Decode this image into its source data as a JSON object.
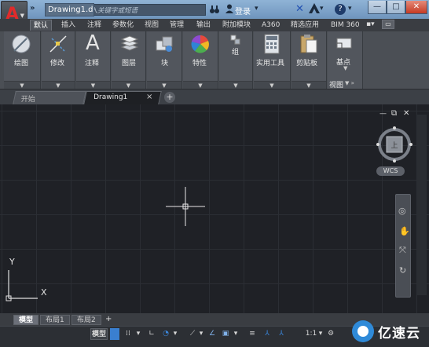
{
  "titlebar": {
    "document_title": "Drawing1.d...",
    "search_placeholder": "键入关键字或短语",
    "login_label": "登录",
    "help_label": "?",
    "min_label": "—",
    "max_label": "□",
    "close_label": "✕"
  },
  "ribbon_tabs": [
    {
      "label": "默认",
      "active": true
    },
    {
      "label": "插入"
    },
    {
      "label": "注释"
    },
    {
      "label": "参数化"
    },
    {
      "label": "视图"
    },
    {
      "label": "管理"
    },
    {
      "label": "输出"
    },
    {
      "label": "附加模块"
    },
    {
      "label": "A360"
    },
    {
      "label": "精选应用"
    },
    {
      "label": "BIM 360"
    }
  ],
  "ribbon_panels": [
    {
      "label": "绘图",
      "icon": "draw-icon"
    },
    {
      "label": "修改",
      "icon": "modify-icon"
    },
    {
      "label": "注释",
      "icon": "annotate-icon",
      "glyph": "A"
    },
    {
      "label": "图层",
      "icon": "layers-icon"
    },
    {
      "label": "块",
      "icon": "block-icon"
    },
    {
      "label": "特性",
      "icon": "properties-icon"
    },
    {
      "label": "组",
      "icon": "group-icon"
    },
    {
      "label": "实用工具",
      "icon": "utilities-icon"
    },
    {
      "label": "剪贴板",
      "icon": "clipboard-icon"
    },
    {
      "label": "基点",
      "icon": "basepoint-icon"
    },
    {
      "label": "视图",
      "icon": "view-panel"
    }
  ],
  "doc_tabs": {
    "start": "开始",
    "drawing": "Drawing1",
    "close": "×",
    "add": "+"
  },
  "viewcube": {
    "wcs_label": "WCS",
    "top_label": "上"
  },
  "ucs": {
    "x_label": "X",
    "y_label": "Y"
  },
  "layout_tabs": [
    {
      "label": "模型",
      "active": true
    },
    {
      "label": "布局1"
    },
    {
      "label": "布局2"
    },
    {
      "label": "+"
    }
  ],
  "statusbar": {
    "model_label": "模型",
    "scale_label": "1:1"
  },
  "watermark": {
    "text": "亿速云"
  },
  "colors": {
    "canvas": "#1f2126",
    "ribbon": "#4b4f55",
    "titlebar": "#7fa3c9",
    "close": "#c53b24"
  }
}
